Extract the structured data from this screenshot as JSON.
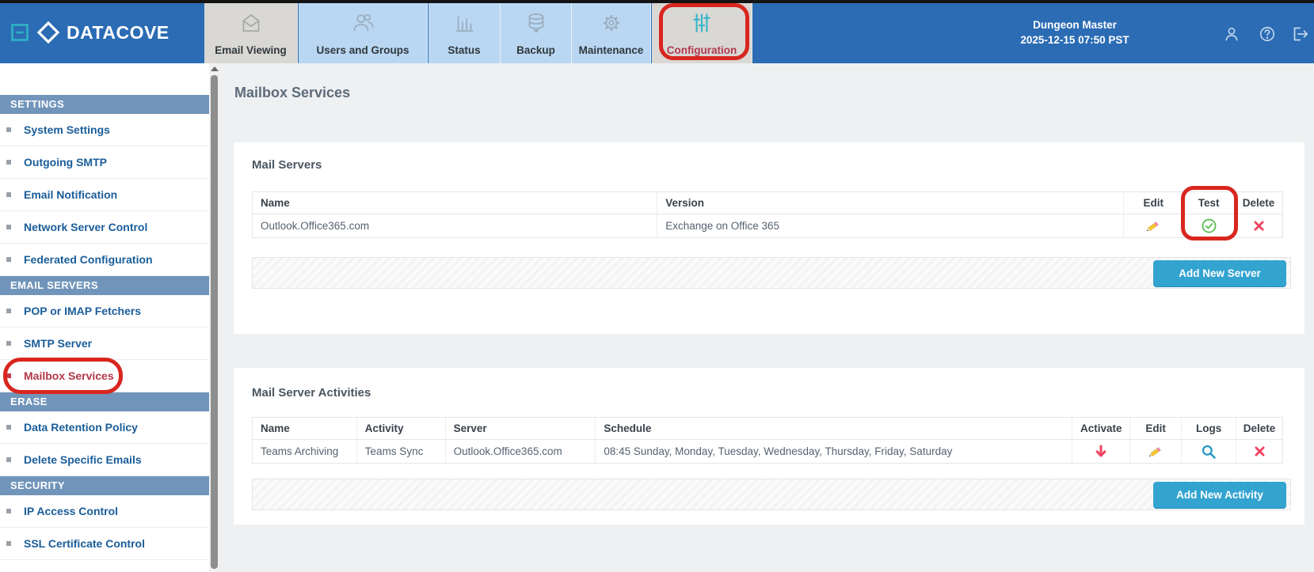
{
  "brand": {
    "name": "DATACOVE"
  },
  "topbar": {
    "tabs": [
      {
        "label": "Email Viewing",
        "icon": "envelope-icon"
      },
      {
        "label": "Users and Groups",
        "icon": "users-icon"
      },
      {
        "label": "Status",
        "icon": "bar-chart-icon"
      },
      {
        "label": "Backup",
        "icon": "database-icon"
      },
      {
        "label": "Maintenance",
        "icon": "gear-icon"
      },
      {
        "label": "Configuration",
        "icon": "sliders-icon"
      }
    ],
    "user_name": "Dungeon Master",
    "datetime": "2025-12-15 07:50 PST"
  },
  "sidebar": {
    "sections": [
      {
        "title": "SETTINGS",
        "items": [
          {
            "label": "System Settings"
          },
          {
            "label": "Outgoing SMTP"
          },
          {
            "label": "Email Notification"
          },
          {
            "label": "Network Server Control"
          },
          {
            "label": "Federated Configuration"
          }
        ]
      },
      {
        "title": "EMAIL SERVERS",
        "items": [
          {
            "label": "POP or IMAP Fetchers"
          },
          {
            "label": "SMTP Server"
          },
          {
            "label": "Mailbox Services",
            "active": true
          }
        ]
      },
      {
        "title": "ERASE",
        "items": [
          {
            "label": "Data Retention Policy"
          },
          {
            "label": "Delete Specific Emails"
          }
        ]
      },
      {
        "title": "SECURITY",
        "items": [
          {
            "label": "IP Access Control"
          },
          {
            "label": "SSL Certificate Control"
          }
        ]
      }
    ]
  },
  "main": {
    "page_title": "Mailbox Services",
    "mail_servers": {
      "heading": "Mail Servers",
      "columns": [
        "Name",
        "Version",
        "Edit",
        "Test",
        "Delete"
      ],
      "rows": [
        {
          "name": "Outlook.Office365.com",
          "version": "Exchange on Office 365"
        }
      ],
      "add_button": "Add New Server"
    },
    "mail_server_activities": {
      "heading": "Mail Server Activities",
      "columns": [
        "Name",
        "Activity",
        "Server",
        "Schedule",
        "Activate",
        "Edit",
        "Logs",
        "Delete"
      ],
      "rows": [
        {
          "name": "Teams Archiving",
          "activity": "Teams Sync",
          "server": "Outlook.Office365.com",
          "schedule": "08:45 Sunday, Monday, Tuesday, Wednesday, Thursday, Friday, Saturday"
        }
      ],
      "add_button": "Add New Activity"
    }
  },
  "annotations": [
    {
      "target": "configuration-tab"
    },
    {
      "target": "sidebar-item-mailbox-services"
    },
    {
      "target": "test-column"
    }
  ],
  "colors": {
    "topbar_blue": "#2b6cb4",
    "tab_blue": "#b9d7f2",
    "tab_active_gray": "#d9d8d4",
    "sidebar_section_bg": "#7195ba",
    "sidebar_link": "#1a5d99",
    "highlight_red_text": "#b23648",
    "annotation_red": "#d8261f",
    "button_blue": "#33a3d0",
    "icon_pink_red": "#ef4460",
    "icon_green": "#56b94c",
    "icon_search_blue": "#2196c4",
    "config_icon_teal": "#35b6c9"
  }
}
